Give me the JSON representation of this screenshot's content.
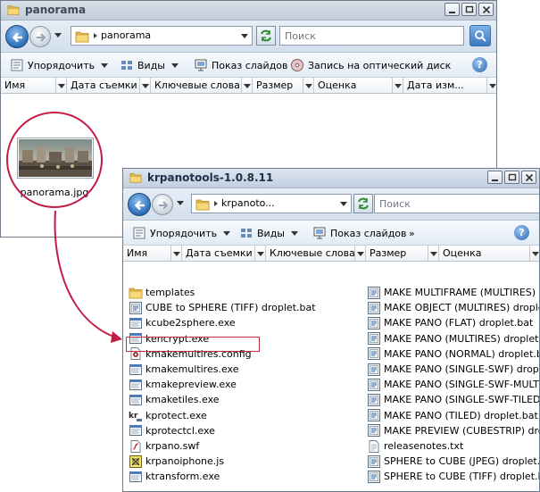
{
  "window1": {
    "title": "panorama",
    "address": "panorama",
    "search_placeholder": "Поиск",
    "toolbar": {
      "organize": "Упорядочить",
      "views": "Виды",
      "slideshow": "Показ слайдов",
      "burn": "Запись на оптический диск"
    },
    "columns": [
      "Имя",
      "Дата съемки",
      "Ключевые слова",
      "Размер",
      "Оценка",
      "Дата изм..."
    ],
    "file": {
      "name": "panorama.jpg"
    }
  },
  "window2": {
    "title": "krpanotools-1.0.8.11",
    "address": "krpanoto...",
    "search_placeholder": "Поиск",
    "toolbar": {
      "organize": "Упорядочить",
      "views": "Виды",
      "slideshow": "Показ слайдов",
      "more": "»"
    },
    "columns": [
      "Имя",
      "Дата съемки",
      "Ключевые слова",
      "Размер",
      "Оценка"
    ],
    "files_left": [
      {
        "name": "templates",
        "icon": "folder-icon"
      },
      {
        "name": "CUBE to SPHERE (TIFF) droplet.bat",
        "icon": "batch-file-icon"
      },
      {
        "name": "kcube2sphere.exe",
        "icon": "exe-file-icon"
      },
      {
        "name": "kencrypt.exe",
        "icon": "exe-file-icon"
      },
      {
        "name": "kmakemultires.config",
        "icon": "config-file-icon"
      },
      {
        "name": "kmakemultires.exe",
        "icon": "exe-file-icon"
      },
      {
        "name": "kmakepreview.exe",
        "icon": "exe-file-icon"
      },
      {
        "name": "kmaketiles.exe",
        "icon": "exe-file-icon"
      },
      {
        "name": "kprotect.exe",
        "icon": "kr-exe-icon"
      },
      {
        "name": "kprotectcl.exe",
        "icon": "exe-file-icon"
      },
      {
        "name": "krpano.swf",
        "icon": "swf-file-icon"
      },
      {
        "name": "krpanoiphone.js",
        "icon": "js-file-icon"
      },
      {
        "name": "ktransform.exe",
        "icon": "exe-file-icon"
      }
    ],
    "files_right": [
      {
        "name": "MAKE MULTIFRAME (MULTIRES) droplet.bat",
        "icon": "batch-file-icon"
      },
      {
        "name": "MAKE OBJECT (MULTIRES) droplet.bat",
        "icon": "batch-file-icon"
      },
      {
        "name": "MAKE PANO (FLAT) droplet.bat",
        "icon": "batch-file-icon"
      },
      {
        "name": "MAKE PANO (MULTIRES) droplet.bat",
        "icon": "batch-file-icon"
      },
      {
        "name": "MAKE PANO (NORMAL) droplet.bat",
        "icon": "batch-file-icon"
      },
      {
        "name": "MAKE PANO (SINGLE-SWF) droplet.bat",
        "icon": "batch-file-icon"
      },
      {
        "name": "MAKE PANO (SINGLE-SWF-MULTIRES) droplet.bat",
        "icon": "batch-file-icon"
      },
      {
        "name": "MAKE PANO (SINGLE-SWF-TILED) droplet.bat",
        "icon": "batch-file-icon"
      },
      {
        "name": "MAKE PANO (TILED) droplet.bat",
        "icon": "batch-file-icon"
      },
      {
        "name": "MAKE PREVIEW (CUBESTRIP) droplet.bat",
        "icon": "batch-file-icon"
      },
      {
        "name": "releasenotes.txt",
        "icon": "text-file-icon"
      },
      {
        "name": "SPHERE to CUBE (JPEG) droplet.bat",
        "icon": "batch-file-icon"
      },
      {
        "name": "SPHERE to CUBE (TIFF) droplet.bat",
        "icon": "batch-file-icon"
      }
    ],
    "highlighted": "kmakemultires.exe"
  },
  "colors": {
    "annotation": "#c21c45",
    "folder": "#f2c94c",
    "title_text": "#1f2f46"
  }
}
